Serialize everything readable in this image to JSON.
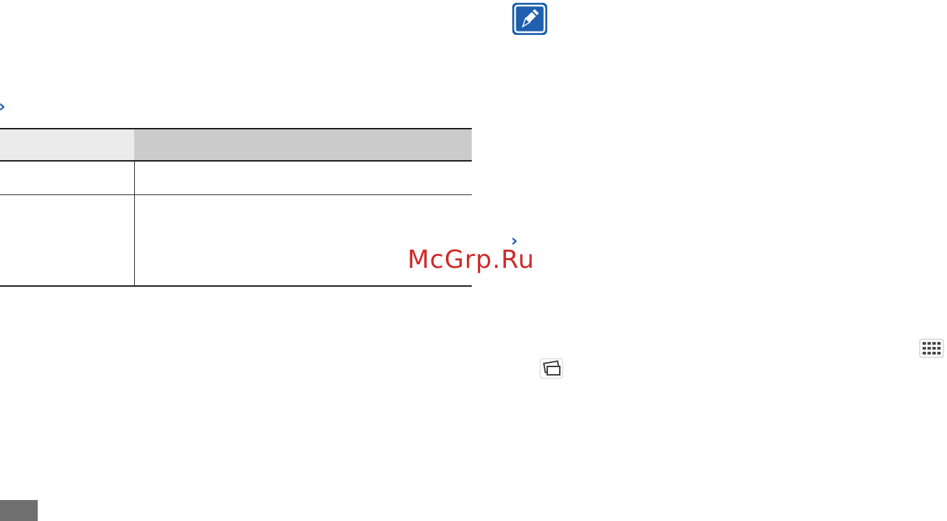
{
  "left_section": {
    "chevron": "›"
  },
  "right_section": {
    "chevron": "›"
  },
  "watermark": {
    "text": "McGrp.Ru"
  },
  "icons": {
    "note": "note-pencil-icon",
    "apps_grid": "apps-grid-icon",
    "gallery": "gallery-icon"
  },
  "colors": {
    "accent": "#1f5fae",
    "watermark": "#cf2a2a",
    "table_header_left": "#ebebeb",
    "table_header_right": "#cbcbcb",
    "page_tab": "#6f6f6f"
  }
}
